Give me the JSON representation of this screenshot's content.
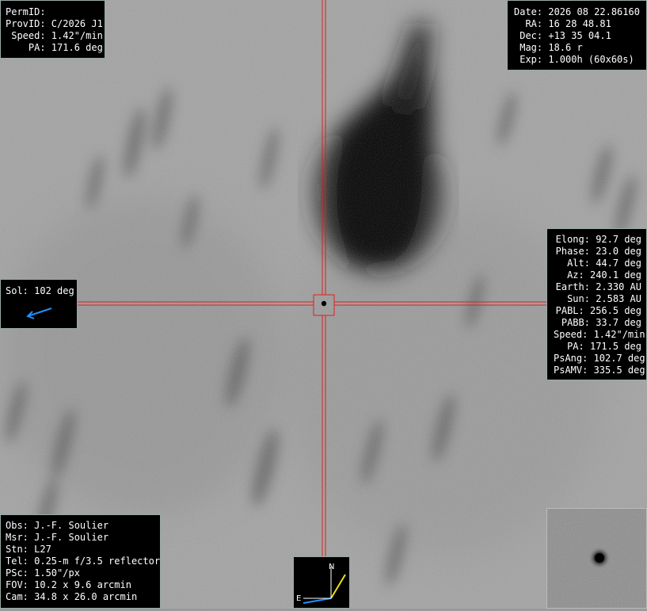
{
  "object_panel": {
    "permid": "PermID:",
    "provid": "ProvID: C/2026 J1",
    "speed": " Speed: 1.42\"/min",
    "pa": "    PA: 171.6 deg"
  },
  "obs_panel": {
    "date": "Date: 2026 08 22.86160",
    "ra": "  RA: 16 28 48.81",
    "dec": " Dec: +13 35 04.1",
    "mag": " Mag: 18.6 r",
    "exp": " Exp: 1.000h (60x60s)"
  },
  "geometry_panel": {
    "elong": "Elong: 92.7 deg",
    "phase": "Phase: 23.0 deg",
    "alt": "Alt: 44.7 deg",
    "az": "Az: 240.1 deg",
    "earth": "Earth: 2.330 AU",
    "sun": "Sun: 2.583 AU",
    "pabl": "PABL: 256.5 deg",
    "pabb": "PABB: 33.7 deg",
    "speed": "Speed: 1.42\"/min",
    "pa": "PA: 171.5 deg",
    "psang": "PsAng: 102.7 deg",
    "psamv": "PsAMV: 335.5 deg"
  },
  "sol_panel": {
    "label": "Sol: 102 deg",
    "arrow_color": "#1e90ff"
  },
  "observer_panel": {
    "obs": "Obs: J.-F. Soulier",
    "msr": "Msr: J.-F. Soulier",
    "stn": "Stn: L27",
    "tel": "Tel: 0.25-m f/3.5 reflector",
    "psc": "PSc: 1.50\"/px",
    "fov": "FOV: 10.2 x 9.6 arcmin",
    "cam": "Cam: 34.8 x 26.0 arcmin"
  },
  "compass": {
    "north_label": "N",
    "east_label": "E",
    "north_color": "#f0e010",
    "east_color": "#1e90ff"
  },
  "crosshair": {
    "color": "#e02020"
  },
  "image": {
    "background_color": "#9a9a9a",
    "target_icon": "comet-nucleus"
  }
}
